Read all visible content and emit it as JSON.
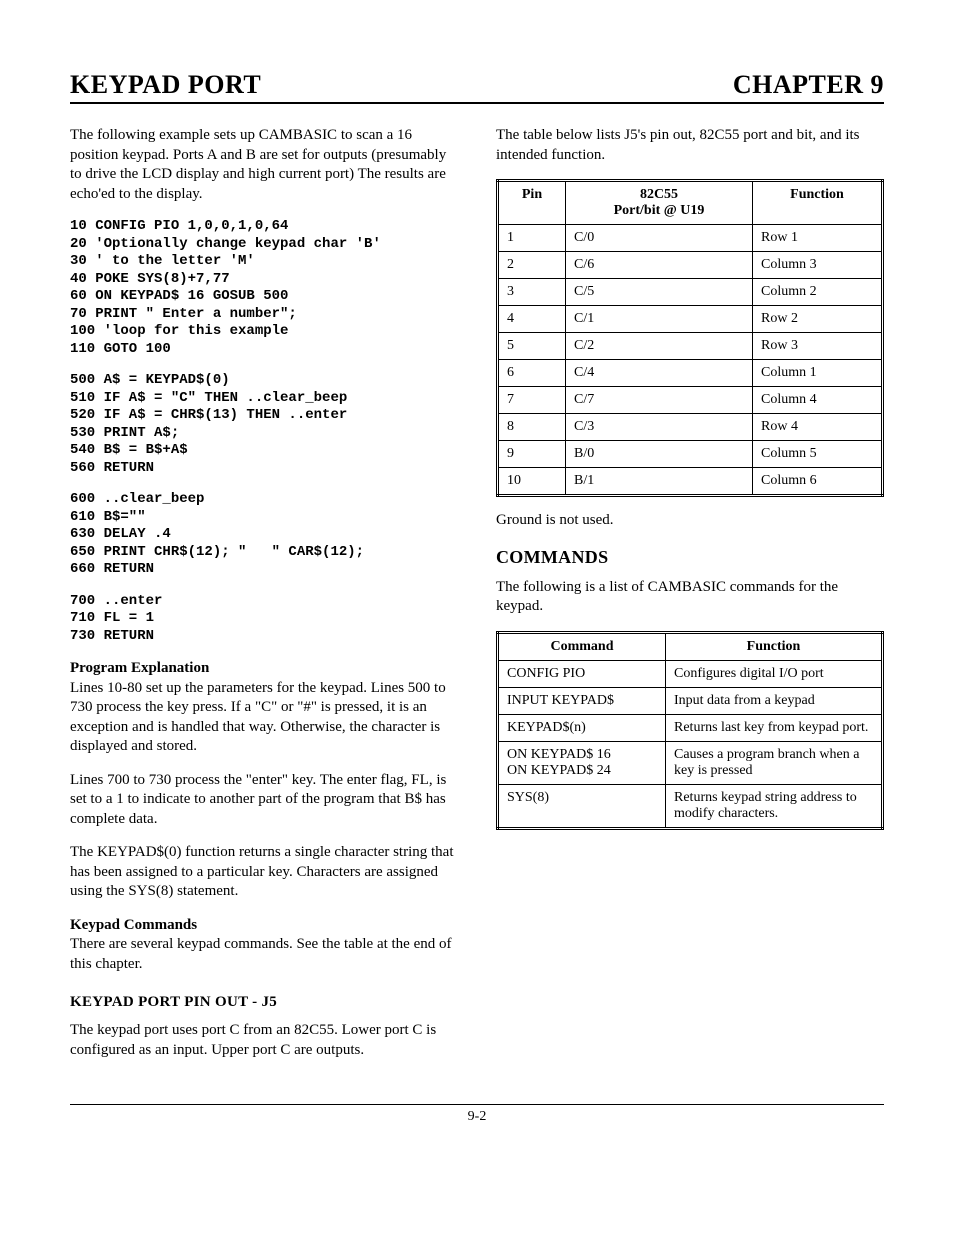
{
  "header": {
    "left": "KEYPAD PORT",
    "right": "CHAPTER 9"
  },
  "left_col": {
    "intro": "The following example sets up CAMBASIC to scan a 16 position keypad. Ports A and B are set for outputs (presumably to drive the LCD display and high current port)  The results are echo'ed to the display.",
    "code_block_1": "10 CONFIG PIO 1,0,0,1,0,64\n20 'Optionally change keypad char 'B'\n30 ' to the letter 'M'\n40 POKE SYS(8)+7,77\n60 ON KEYPAD$ 16 GOSUB 500\n70 PRINT \" Enter a number\";\n100 'loop for this example\n110 GOTO 100",
    "code_block_2": "500 A$ = KEYPAD$(0)\n510 IF A$ = \"C\" THEN ..clear_beep\n520 IF A$ = CHR$(13) THEN ..enter\n530 PRINT A$;\n540 B$ = B$+A$\n560 RETURN",
    "code_block_3": "600 ..clear_beep\n610 B$=\"\"\n630 DELAY .4\n650 PRINT CHR$(12); \"   \" CAR$(12);\n660 RETURN",
    "code_block_4": "700 ..enter\n710 FL = 1\n730 RETURN",
    "prog_exp_title": "Program Explanation",
    "prog_exp_1": "Lines 10-80 set up the parameters for the keypad.  Lines 500 to 730 process the key press.  If a \"C\" or \"#\" is pressed, it is an exception and is handled that way. Otherwise, the character is displayed and stored.",
    "prog_exp_2": "Lines 700 to 730 process the \"enter\" key.  The enter flag, FL, is set to a 1 to indicate to another part of the program that B$ has complete data.",
    "prog_exp_3": "The KEYPAD$(0) function returns a single character string that has been assigned to a particular key.  Characters are assigned using the SYS(8) statement.",
    "keypad_cmd_title": "Keypad Commands",
    "keypad_cmd_body": "There are several keypad commands.  See the table at the end of this chapter.",
    "pinout_heading": "KEYPAD PORT PIN OUT - J5",
    "pinout_body": "The keypad port uses port C from an 82C55.  Lower port C is configured as an input.  Upper port C are outputs."
  },
  "right_col": {
    "intro": "The table below lists J5's pin out, 82C55 port and bit, and its intended function.",
    "pin_table": {
      "headers": [
        "Pin",
        "82C55\nPort/bit @ U19",
        "Function"
      ],
      "rows": [
        [
          "1",
          "C/0",
          "Row 1"
        ],
        [
          "2",
          "C/6",
          "Column 3"
        ],
        [
          "3",
          "C/5",
          "Column 2"
        ],
        [
          "4",
          "C/1",
          "Row 2"
        ],
        [
          "5",
          "C/2",
          "Row 3"
        ],
        [
          "6",
          "C/4",
          "Column 1"
        ],
        [
          "7",
          "C/7",
          "Column 4"
        ],
        [
          "8",
          "C/3",
          "Row 4"
        ],
        [
          "9",
          "B/0",
          "Column 5"
        ],
        [
          "10",
          "B/1",
          "Column 6"
        ]
      ]
    },
    "ground_note": "Ground is not used.",
    "commands_heading": "COMMANDS",
    "commands_intro": "The following is a list of CAMBASIC commands for the keypad.",
    "cmd_table": {
      "headers": [
        "Command",
        "Function"
      ],
      "rows": [
        [
          "CONFIG PIO",
          "Configures digital I/O port"
        ],
        [
          "INPUT KEYPAD$",
          "Input data from a keypad"
        ],
        [
          "KEYPAD$(n)",
          "Returns last key from keypad port."
        ],
        [
          "ON KEYPAD$ 16\nON KEYPAD$ 24",
          "Causes a program branch when a key is pressed"
        ],
        [
          "SYS(8)",
          "Returns keypad string address to modify characters."
        ]
      ]
    }
  },
  "footer": "9-2"
}
